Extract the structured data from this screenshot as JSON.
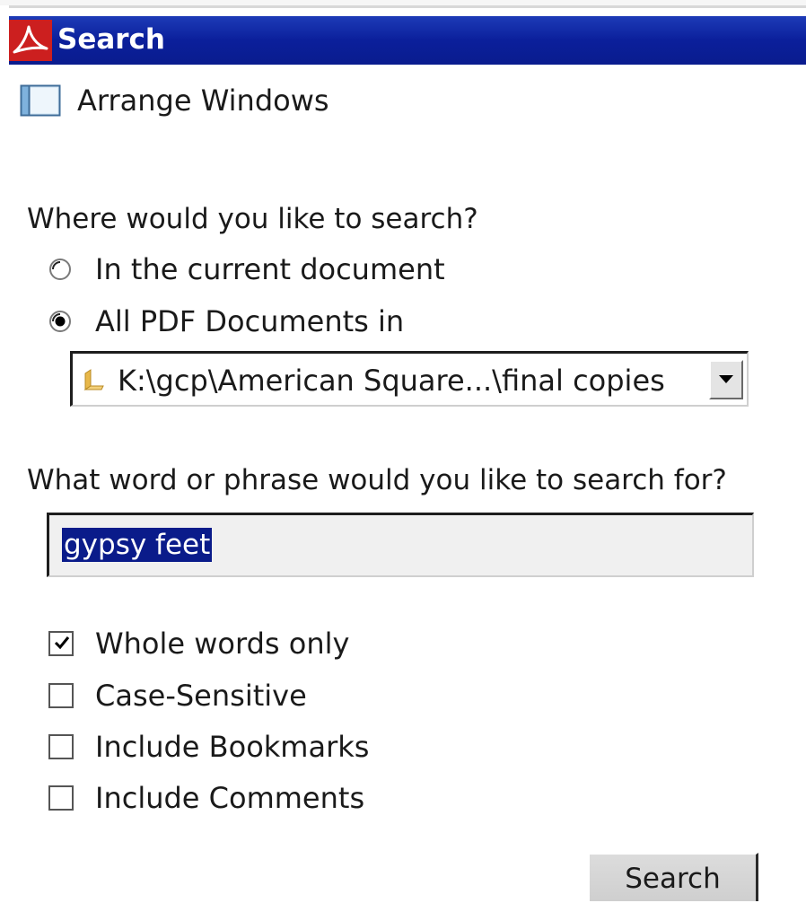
{
  "window": {
    "title": "Search",
    "app_icon": "adobe-reader-icon",
    "title_bar_color": "#0b1f9b"
  },
  "arrange": {
    "icon": "window-layout-icon",
    "label": "Arrange Windows"
  },
  "location": {
    "question": "Where would you like to search?",
    "options": [
      {
        "label": "In the current document",
        "selected": false
      },
      {
        "label": "All PDF Documents in",
        "selected": true
      }
    ],
    "folder": {
      "icon": "folder-icon",
      "value": "K:\\gcp\\American Square...\\final copies"
    }
  },
  "query": {
    "question": "What word or phrase would you like to search for?",
    "value": "gypsy feet",
    "selection_color": "#0a1b8a"
  },
  "options": [
    {
      "label": "Whole words only",
      "checked": true
    },
    {
      "label": "Case-Sensitive",
      "checked": false
    },
    {
      "label": "Include Bookmarks",
      "checked": false
    },
    {
      "label": "Include Comments",
      "checked": false
    }
  ],
  "actions": {
    "search_label": "Search"
  }
}
